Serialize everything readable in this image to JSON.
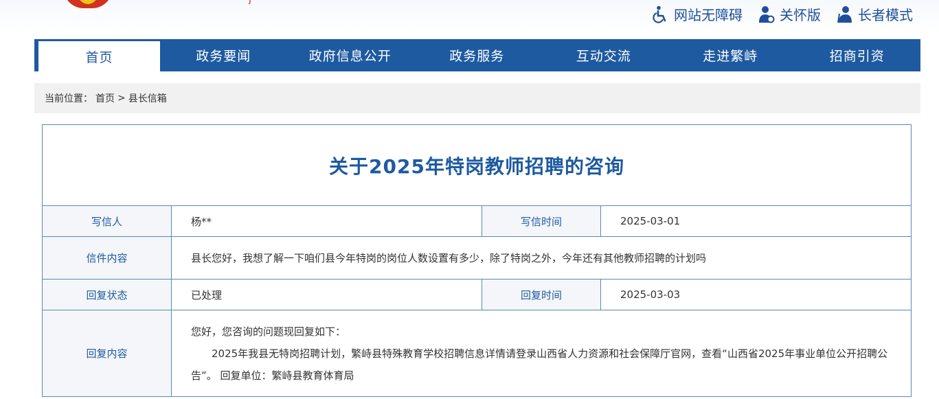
{
  "header": {
    "tools": [
      {
        "icon": "wheelchair-icon",
        "label": "网站无障碍"
      },
      {
        "icon": "care-person-icon",
        "label": "关怀版"
      },
      {
        "icon": "elder-person-icon",
        "label": "长者模式"
      }
    ]
  },
  "nav": {
    "items": [
      {
        "label": "首页"
      },
      {
        "label": "政务要闻"
      },
      {
        "label": "政府信息公开"
      },
      {
        "label": "政务服务"
      },
      {
        "label": "互动交流"
      },
      {
        "label": "走进繁峙"
      },
      {
        "label": "招商引资"
      }
    ]
  },
  "breadcrumb": {
    "prefix": "当前位置：",
    "home": "首页",
    "separator": ">",
    "current": "县长信箱"
  },
  "letter": {
    "title": "关于2025年特岗教师招聘的咨询",
    "writer_label": "写信人",
    "writer": "杨**",
    "date_label": "写信时间",
    "date": "2025-03-01",
    "content_label": "信件内容",
    "content": "县长您好，我想了解一下咱们县今年特岗的岗位人数设置有多少，除了特岗之外，今年还有其他教师招聘的计划吗",
    "status_label": "回复状态",
    "status": "已处理",
    "reply_date_label": "回复时间",
    "reply_date": "2025-03-03",
    "reply_label": "回复内容",
    "reply_line1": "您好，您咨询的问题现回复如下：",
    "reply_line2": "2025年我县无特岗招聘计划，繁峙县特殊教育学校招聘信息详情请登录山西省人力资源和社会保障厅官网，查看“山西省2025年事业单位公开招聘公告”。  回复单位：繁峙县教育体育局"
  },
  "colors": {
    "primary": "#1e5aa0",
    "border": "#5b88b5",
    "crumb_bg": "#f1f1f1"
  }
}
